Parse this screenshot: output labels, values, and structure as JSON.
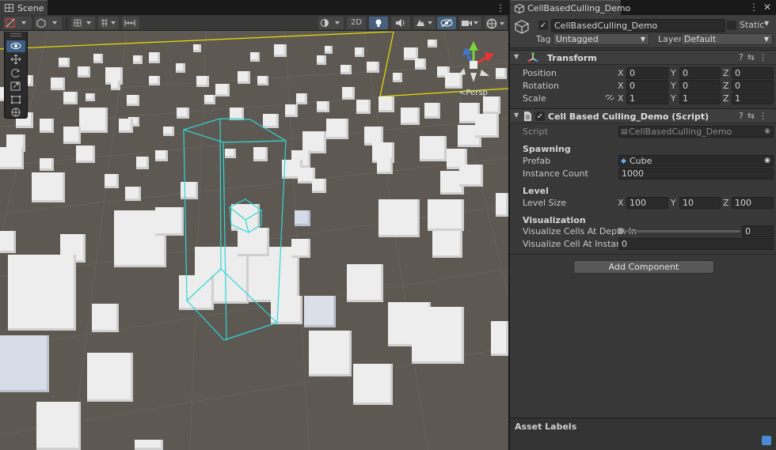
{
  "scene": {
    "tab_label": "Scene",
    "toolbar": {
      "mode_2d": "2D"
    },
    "persp_label": "<Persp"
  },
  "inspector": {
    "tab_label": "CellBasedCulling_Demo",
    "object_name": "CellBasedCulling_Demo",
    "static_label": "Static",
    "tag_label": "Tag",
    "tag_value": "Untagged",
    "layer_label": "Layer",
    "layer_value": "Default",
    "transform": {
      "title": "Transform",
      "position_label": "Position",
      "rotation_label": "Rotation",
      "scale_label": "Scale",
      "position": {
        "x": "0",
        "y": "0",
        "z": "0"
      },
      "rotation": {
        "x": "0",
        "y": "0",
        "z": "0"
      },
      "scale": {
        "x": "1",
        "y": "1",
        "z": "1"
      }
    },
    "script_component": {
      "title": "Cell Based Culling_Demo (Script)",
      "script_label": "Script",
      "script_value": "CellBasedCulling_Demo",
      "spawning_header": "Spawning",
      "prefab_label": "Prefab",
      "prefab_value": "Cube",
      "instance_count_label": "Instance Count",
      "instance_count_value": "1000",
      "level_header": "Level",
      "level_size_label": "Level Size",
      "level_size": {
        "x": "100",
        "y": "10",
        "z": "100"
      },
      "visualization_header": "Visualization",
      "depth_label": "Visualize Cells At Depth In",
      "depth_value": "0",
      "instance_label": "Visualize Cell At Instance",
      "instance_value": "0"
    },
    "axis": {
      "x": "X",
      "y": "Y",
      "z": "Z"
    },
    "add_component_label": "Add Component",
    "asset_labels_header": "Asset Labels"
  },
  "colors": {
    "viewport_bg": "#5d5852",
    "accent_blue": "#3d5f85",
    "selection_cyan": "#2fd6d6",
    "bounds_yellow": "#e6e000"
  }
}
